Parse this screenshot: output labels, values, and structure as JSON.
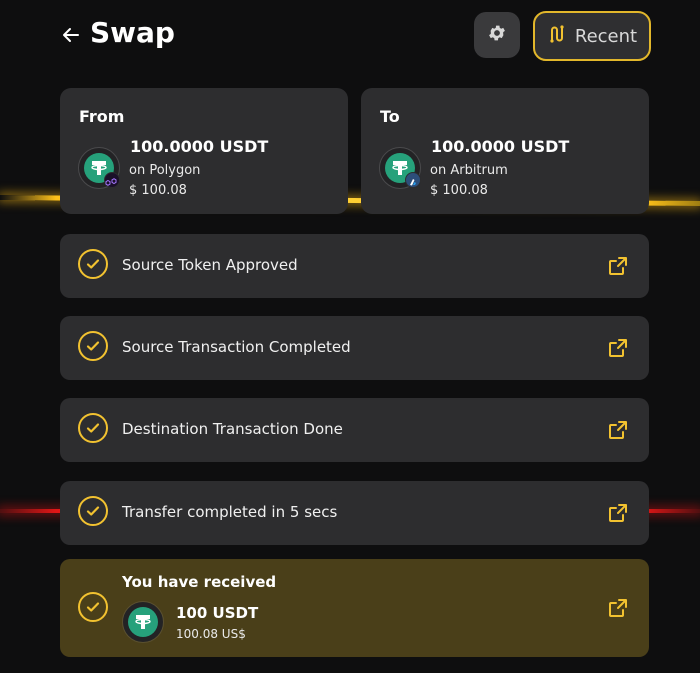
{
  "header": {
    "title": "Swap",
    "back_icon": "arrow-left-icon",
    "settings_icon": "gear-icon",
    "recent_label": "Recent",
    "recent_icon": "route-icon"
  },
  "from": {
    "label": "From",
    "amount": "100.0000 USDT",
    "chain": "on Polygon",
    "usd": "$ 100.08",
    "token_icon": "tether-icon",
    "chain_icon": "polygon-icon"
  },
  "to": {
    "label": "To",
    "amount": "100.0000 USDT",
    "chain": "on Arbitrum",
    "usd": "$ 100.08",
    "token_icon": "tether-icon",
    "chain_icon": "arbitrum-icon"
  },
  "steps": [
    {
      "label": "Source Token Approved",
      "status": "done"
    },
    {
      "label": "Source Transaction Completed",
      "status": "done"
    },
    {
      "label": "Destination Transaction Done",
      "status": "done"
    },
    {
      "label": "Transfer completed in 5 secs",
      "status": "done"
    }
  ],
  "received": {
    "title": "You have received",
    "amount": "100 USDT",
    "usd": "100.08 US$",
    "token_icon": "tether-icon"
  },
  "colors": {
    "accent": "#f2c230",
    "card_bg": "#2d2d2f",
    "received_bg": "#4a3f19",
    "page_bg": "#0e0e0f",
    "tether": "#26a17b"
  }
}
